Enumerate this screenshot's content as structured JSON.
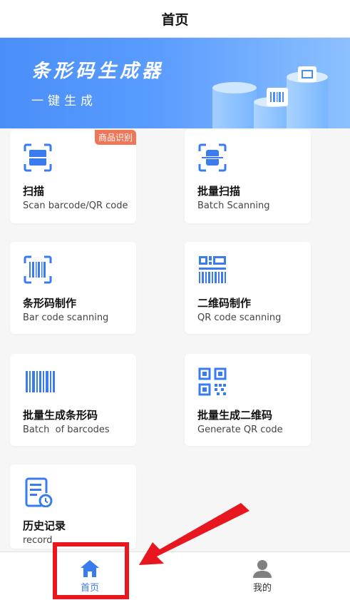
{
  "header": {
    "title": "首页"
  },
  "banner": {
    "title": "条形码生成器",
    "subtitle": "一键生成",
    "accent_color": "#4a8ef8"
  },
  "cards": [
    {
      "id": "scan",
      "label": "扫描",
      "sub": "Scan barcode/QR code",
      "tag": "商品识别",
      "icon": "scan-frame-icon"
    },
    {
      "id": "batch-scan",
      "label": "批量扫描",
      "sub": "Batch Scanning",
      "icon": "batch-scan-icon"
    },
    {
      "id": "barcode-make",
      "label": "条形码制作",
      "sub": "Bar code scanning",
      "icon": "barcode-frame-icon"
    },
    {
      "id": "qr-make",
      "label": "二维码制作",
      "sub": "QR code scanning",
      "icon": "qr-barcode-icon"
    },
    {
      "id": "batch-barcode",
      "label": "批量生成条形码",
      "sub": "Batch  of barcodes",
      "icon": "barcode-icon"
    },
    {
      "id": "batch-qr",
      "label": "批量生成二维码",
      "sub": "Generate QR code",
      "icon": "qr-code-icon"
    },
    {
      "id": "history",
      "label": "历史记录",
      "sub": "record",
      "icon": "history-document-icon"
    }
  ],
  "tabbar": {
    "home_label": "首页",
    "me_label": "我的",
    "active_color": "#3a7cf0",
    "inactive_color": "#808080"
  },
  "annotation": {
    "highlight_color": "#e8161e"
  }
}
